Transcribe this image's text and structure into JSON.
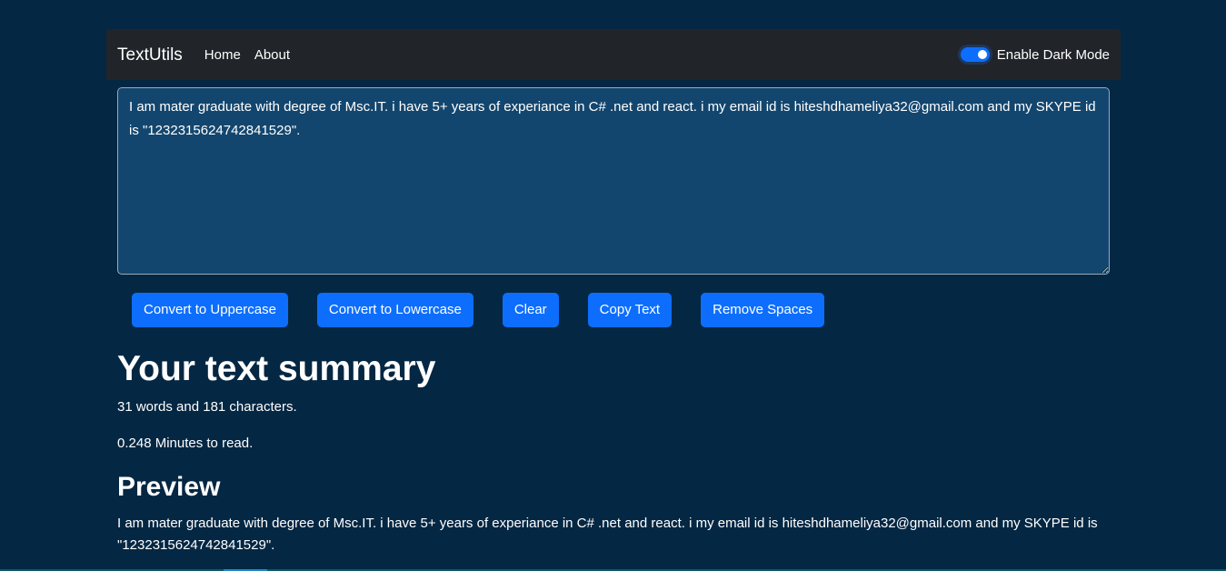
{
  "navbar": {
    "brand": "TextUtils",
    "links": [
      {
        "label": "Home"
      },
      {
        "label": "About"
      }
    ],
    "dark_mode_toggle": {
      "label": "Enable Dark Mode",
      "checked": true
    }
  },
  "editor": {
    "value": "I am mater graduate with degree of Msc.IT. i have 5+ years of experiance in C# .net and react. i my email id is hiteshdhameliya32@gmail.com and my SKYPE id is \"1232315624742841529\"."
  },
  "buttons": {
    "uppercase": "Convert to Uppercase",
    "lowercase": "Convert to Lowercase",
    "clear": "Clear",
    "copy": "Copy Text",
    "remove_spaces": "Remove Spaces"
  },
  "summary": {
    "heading": "Your text summary",
    "counts": "31 words and 181 characters.",
    "read_time": "0.248 Minutes to read."
  },
  "preview": {
    "heading": "Preview",
    "text": "I am mater graduate with degree of Msc.IT. i have 5+ years of experiance in C# .net and react. i my email id is hiteshdhameliya32@gmail.com and my SKYPE id is \"1232315624742841529\"."
  },
  "colors": {
    "background": "#042743",
    "navbar": "#212529",
    "textarea": "#13466e",
    "primary": "#0d6efd"
  }
}
